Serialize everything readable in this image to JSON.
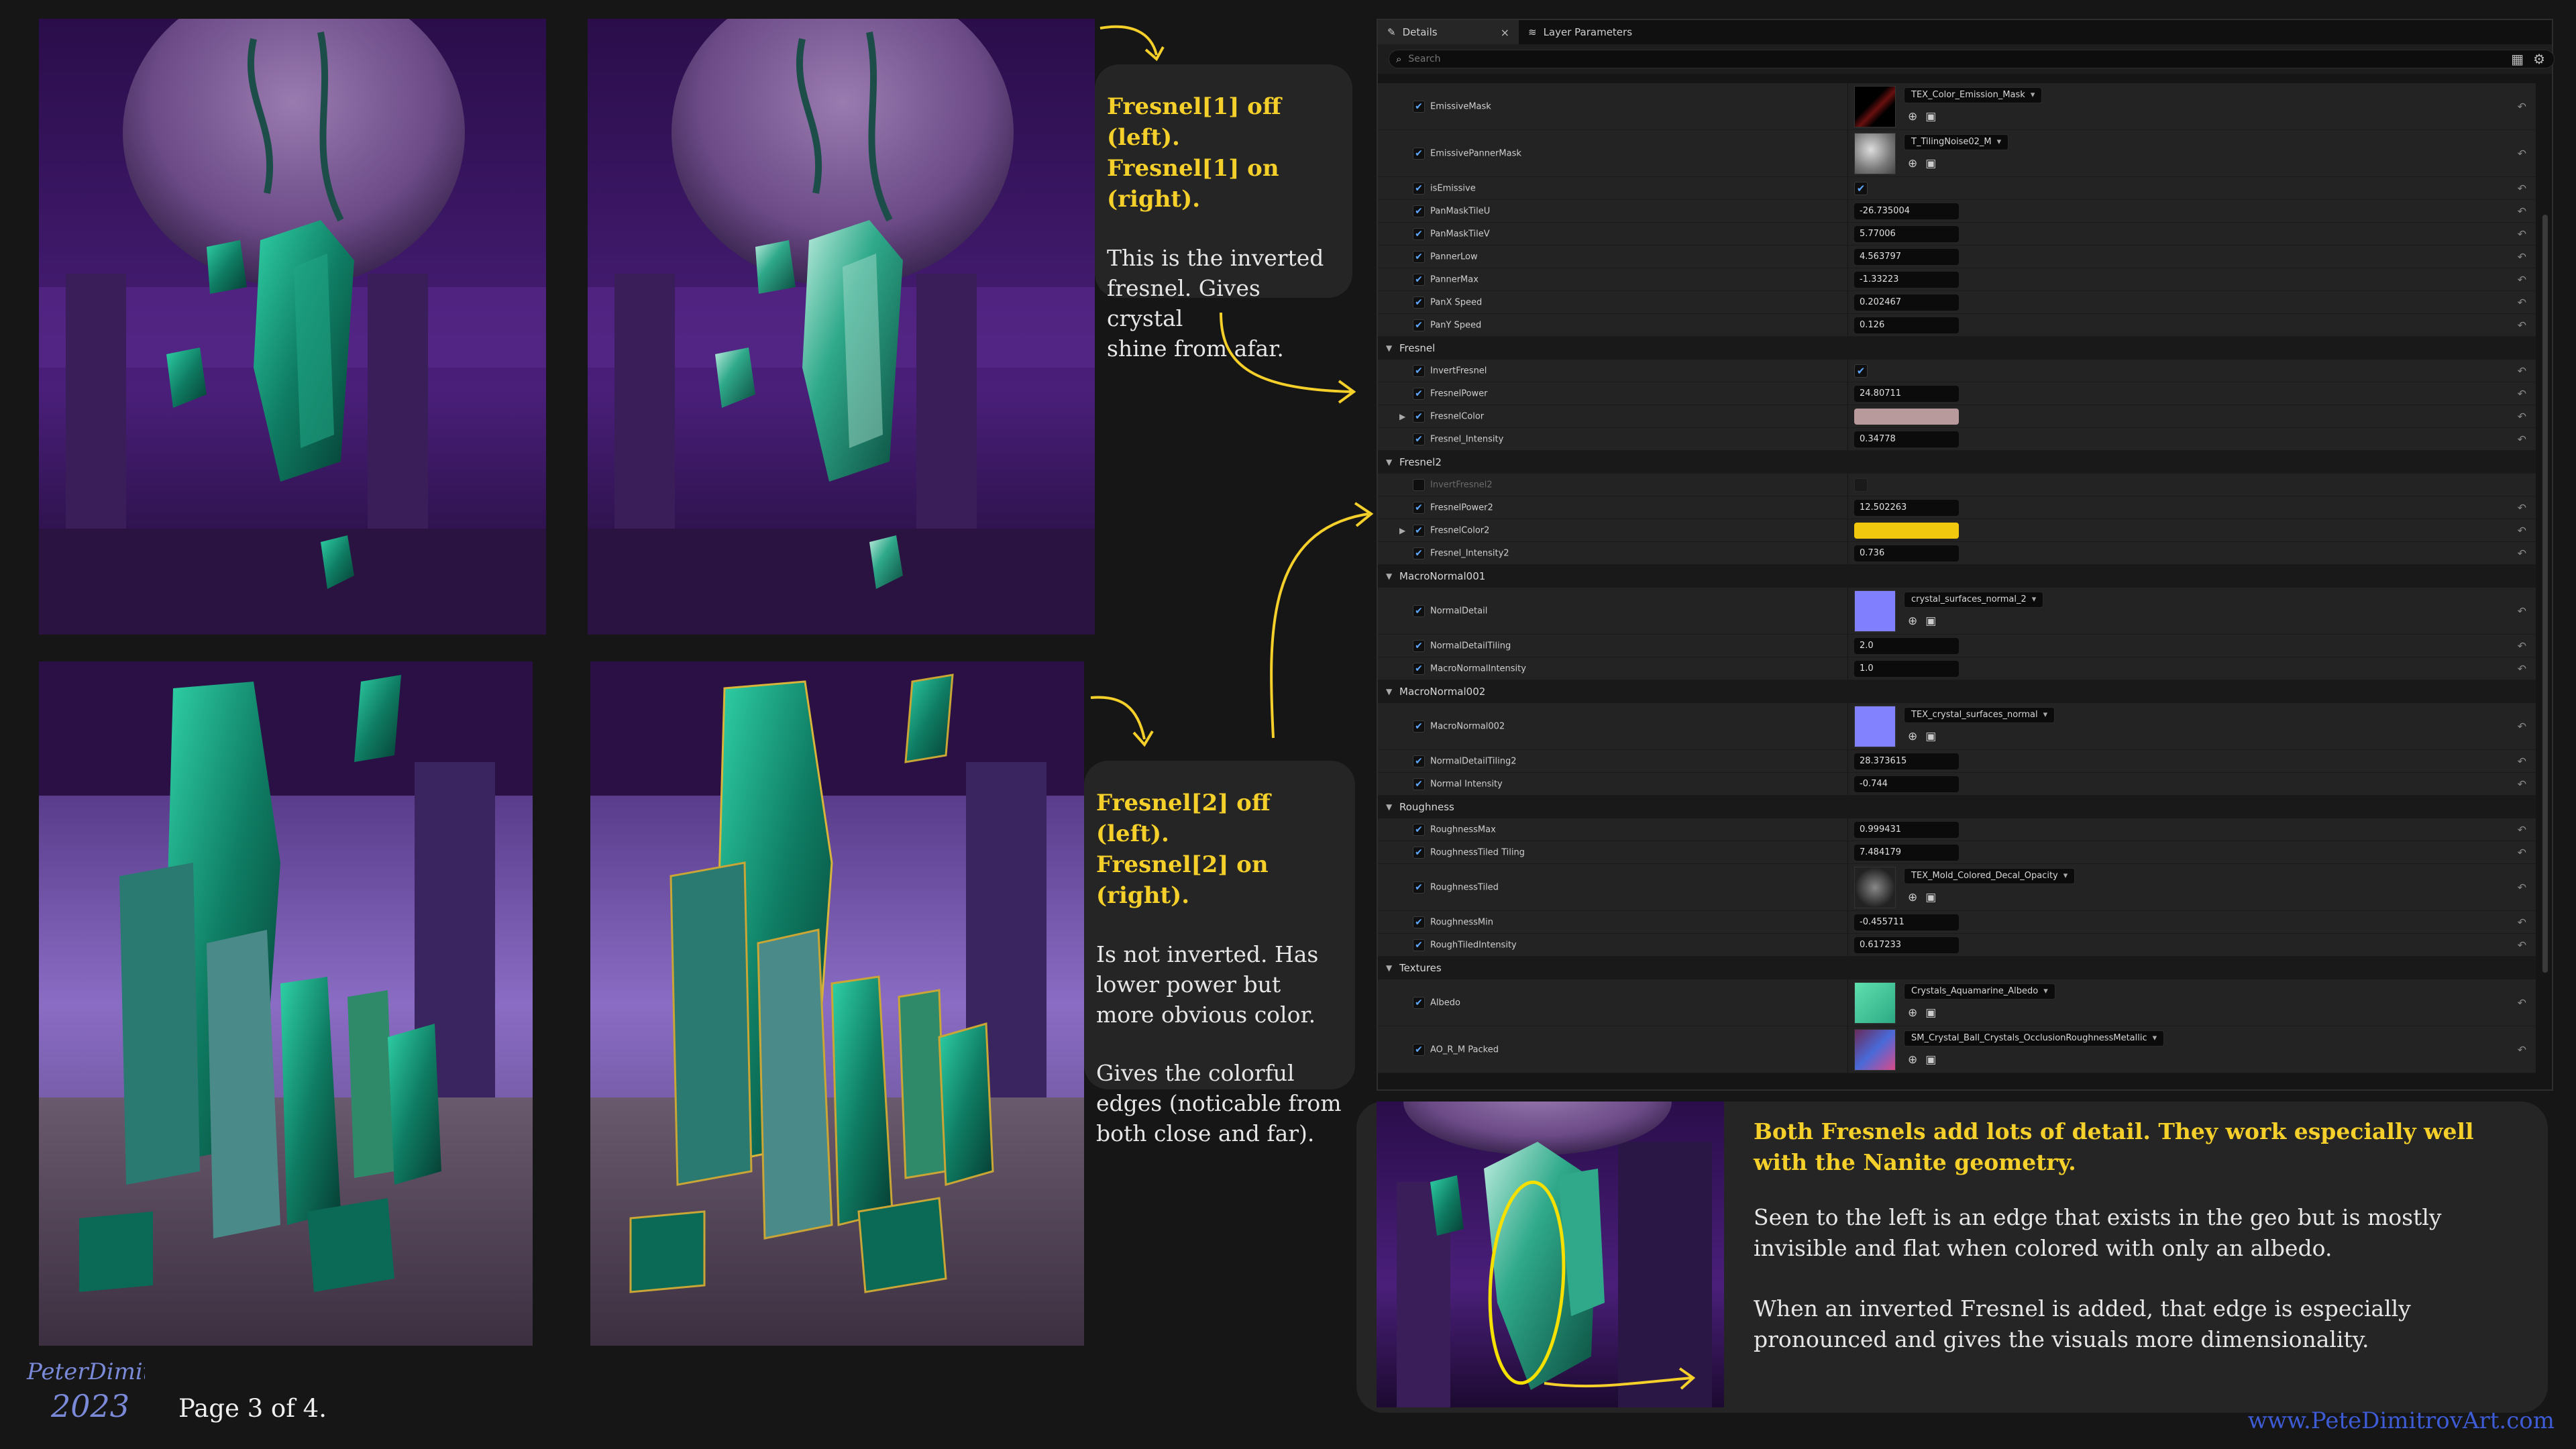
{
  "callouts": {
    "fresnel1": {
      "line1": "Fresnel[1] off (left).",
      "line2": "Fresnel[1] on (right).",
      "body": [
        "This is the inverted",
        "fresnel. Gives crystal",
        "shine from afar."
      ]
    },
    "fresnel2": {
      "line1": "Fresnel[2] off (left).",
      "line2": "Fresnel[2] on (right).",
      "body1": [
        "Is not inverted. Has",
        "lower power but",
        "more obvious color."
      ],
      "body2": [
        "Gives the colorful",
        "edges (noticable from",
        "both close and far)."
      ]
    }
  },
  "panel": {
    "tabs": [
      {
        "label": "Details",
        "icon": "pencil-icon"
      },
      {
        "label": "Layer Parameters",
        "icon": "layers-icon"
      }
    ],
    "search_placeholder": "Search",
    "rows": [
      {
        "type": "texture",
        "name": "EmissiveMask",
        "asset": "TEX_Color_Emission_Mask"
      },
      {
        "type": "texture",
        "name": "EmissivePannerMask",
        "asset": "T_TilingNoise02_M"
      },
      {
        "type": "check",
        "name": "isEmissive",
        "checked": true
      },
      {
        "type": "number",
        "name": "PanMaskTileU",
        "value": "-26.735004"
      },
      {
        "type": "number",
        "name": "PanMaskTileV",
        "value": "5.77006"
      },
      {
        "type": "number",
        "name": "PannerLow",
        "value": "4.563797"
      },
      {
        "type": "number",
        "name": "PannerMax",
        "value": "-1.33223"
      },
      {
        "type": "number",
        "name": "PanX Speed",
        "value": "0.202467"
      },
      {
        "type": "number",
        "name": "PanY Speed",
        "value": "0.126"
      },
      {
        "type": "category",
        "name": "Fresnel"
      },
      {
        "type": "check",
        "name": "InvertFresnel",
        "checked": true
      },
      {
        "type": "number",
        "name": "FresnelPower",
        "value": "24.80711"
      },
      {
        "type": "color",
        "name": "FresnelColor",
        "color": "#b89a9c",
        "expandable": true
      },
      {
        "type": "number",
        "name": "Fresnel_Intensity",
        "value": "0.34778"
      },
      {
        "type": "category",
        "name": "Fresnel2"
      },
      {
        "type": "check",
        "name": "InvertFresnel2",
        "checked": false,
        "disabled": true
      },
      {
        "type": "number",
        "name": "FresnelPower2",
        "value": "12.502263"
      },
      {
        "type": "color",
        "name": "FresnelColor2",
        "color": "#f2c80f",
        "expandable": true
      },
      {
        "type": "number",
        "name": "Fresnel_Intensity2",
        "value": "0.736"
      },
      {
        "type": "category",
        "name": "MacroNormal001"
      },
      {
        "type": "texture",
        "name": "NormalDetail",
        "asset": "crystal_surfaces_normal_2"
      },
      {
        "type": "number",
        "name": "NormalDetailTiling",
        "value": "2.0"
      },
      {
        "type": "number",
        "name": "MacroNormalIntensity",
        "value": "1.0"
      },
      {
        "type": "category",
        "name": "MacroNormal002"
      },
      {
        "type": "texture",
        "name": "MacroNormal002",
        "asset": "TEX_crystal_surfaces_normal"
      },
      {
        "type": "number",
        "name": "NormalDetailTiling2",
        "value": "28.373615"
      },
      {
        "type": "number",
        "name": "Normal Intensity",
        "value": "-0.744"
      },
      {
        "type": "category",
        "name": "Roughness"
      },
      {
        "type": "number",
        "name": "RoughnessMax",
        "value": "0.999431"
      },
      {
        "type": "number",
        "name": "RoughnessTiled Tiling",
        "value": "7.484179"
      },
      {
        "type": "texture",
        "name": "RoughnessTiled",
        "asset": "TEX_Mold_Colored_Decal_Opacity"
      },
      {
        "type": "number",
        "name": "RoughnessMin",
        "value": "-0.455711"
      },
      {
        "type": "number",
        "name": "RoughTiledIntensity",
        "value": "0.617233"
      },
      {
        "type": "category",
        "name": "Textures"
      },
      {
        "type": "texture",
        "name": "Albedo",
        "asset": "Crystals_Aquamarine_Albedo"
      },
      {
        "type": "texture",
        "name": "AO_R_M Packed",
        "asset": "SM_Crystal_Ball_Crystals_OcclusionRoughnessMetallic"
      }
    ]
  },
  "info": {
    "headline": "Both Fresnels add lots of detail. They work especially well with the Nanite geometry.",
    "para1": "Seen to the left is an edge that exists in the geo but is mostly invisible and flat when colored with only an albedo.",
    "para2": "When an inverted Fresnel is added, that edge is especially pronounced and gives the visuals more dimensionality."
  },
  "footer": {
    "page": "Page 3 of 4.",
    "url": "www.PeteDimitrovArt.com",
    "signature_name": "PeterDimitrov",
    "signature_year": "2023"
  },
  "colors": {
    "accent_yellow": "#f5cf2a",
    "url_blue": "#3d5bd4",
    "checkbox_blue": "#5fa8ff"
  }
}
